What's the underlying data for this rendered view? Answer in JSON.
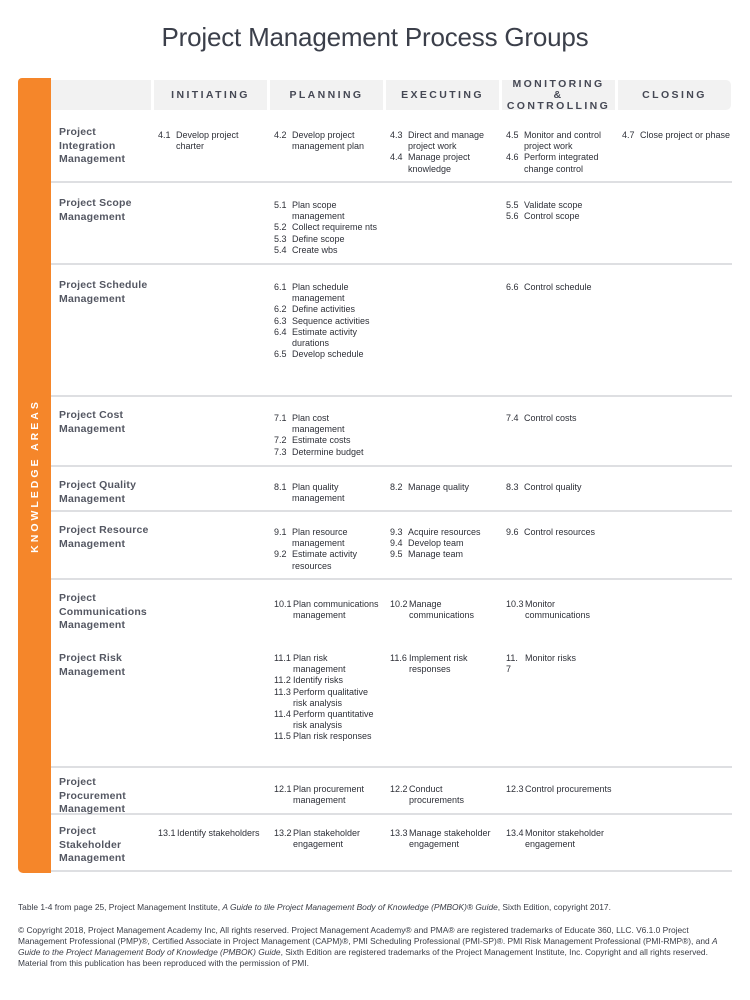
{
  "title": "Project Management Process Groups",
  "side_label": "KNOWLEDGE AREAS",
  "colors": {
    "accent": "#f5862a",
    "header_bg": "#f2f2f2",
    "separator": "#dedfe2"
  },
  "process_groups": [
    "INITIATING",
    "PLANNING",
    "EXECUTING",
    "MONITORING & CONTROLLING",
    "CLOSING"
  ],
  "knowledge_areas": [
    {
      "name": "Project Integration Management",
      "initiating": [
        {
          "num": "4.1",
          "text": "Develop project charter"
        }
      ],
      "planning": [
        {
          "num": "4.2",
          "text": "Develop project management plan"
        }
      ],
      "executing": [
        {
          "num": "4.3",
          "text": "Direct and manage project work"
        },
        {
          "num": "4.4",
          "text": "Manage project knowledge"
        }
      ],
      "monitoring": [
        {
          "num": "4.5",
          "text": "Monitor and control project work"
        },
        {
          "num": "4.6",
          "text": "Perform integrated change control"
        }
      ],
      "closing": [
        {
          "num": "4.7",
          "text": "Close project or phase"
        }
      ]
    },
    {
      "name": "Project Scope Management",
      "initiating": [],
      "planning": [
        {
          "num": "5.1",
          "text": "Plan scope management"
        },
        {
          "num": "5.2",
          "text": "Collect requireme nts"
        },
        {
          "num": "5.3",
          "text": "Define scope"
        },
        {
          "num": "5.4",
          "text": "Create wbs"
        }
      ],
      "executing": [],
      "monitoring": [
        {
          "num": "5.5",
          "text": "Validate scope"
        },
        {
          "num": "5.6",
          "text": "Control scope"
        }
      ],
      "closing": []
    },
    {
      "name": "Project Schedule Management",
      "initiating": [],
      "planning": [
        {
          "num": "6.1",
          "text": "Plan schedule management"
        },
        {
          "num": "6.2",
          "text": "Define activities"
        },
        {
          "num": "6.3",
          "text": "Sequence activities"
        },
        {
          "num": "6.4",
          "text": "Estimate activity durations"
        },
        {
          "num": "6.5",
          "text": "Develop schedule"
        }
      ],
      "executing": [],
      "monitoring": [
        {
          "num": "6.6",
          "text": "Control schedule"
        }
      ],
      "closing": []
    },
    {
      "name": "Project Cost Management",
      "initiating": [],
      "planning": [
        {
          "num": "7.1",
          "text": "Plan cost management"
        },
        {
          "num": "7.2",
          "text": "Estimate costs"
        },
        {
          "num": "7.3",
          "text": "Determine budget"
        }
      ],
      "executing": [],
      "monitoring": [
        {
          "num": "7.4",
          "text": "Control costs"
        }
      ],
      "closing": []
    },
    {
      "name": "Project Quality Management",
      "initiating": [],
      "planning": [
        {
          "num": "8.1",
          "text": "Plan quality management"
        }
      ],
      "executing": [
        {
          "num": "8.2",
          "text": "Manage quality"
        }
      ],
      "monitoring": [
        {
          "num": "8.3",
          "text": "Control quality"
        }
      ],
      "closing": []
    },
    {
      "name": "Project Resource Management",
      "initiating": [],
      "planning": [
        {
          "num": "9.1",
          "text": "Plan resource management"
        },
        {
          "num": "9.2",
          "text": "Estimate activity resources"
        }
      ],
      "executing": [
        {
          "num": "9.3",
          "text": "Acquire resources"
        },
        {
          "num": "9.4",
          "text": "Develop team"
        },
        {
          "num": "9.5",
          "text": "Manage team"
        }
      ],
      "monitoring": [
        {
          "num": "9.6",
          "text": "Control resources"
        }
      ],
      "closing": []
    },
    {
      "name": "Project Communications Management",
      "initiating": [],
      "planning": [
        {
          "num": "10.1",
          "text": "Plan communications management"
        }
      ],
      "executing": [
        {
          "num": "10.2",
          "text": "Manage communications"
        }
      ],
      "monitoring": [
        {
          "num": "10.3",
          "text": "Monitor communications"
        }
      ],
      "closing": []
    },
    {
      "name": "Project Risk Management",
      "initiating": [],
      "planning": [
        {
          "num": "11.1",
          "text": "Plan risk management"
        },
        {
          "num": "11.2",
          "text": "Identify risks"
        },
        {
          "num": "11.3",
          "text": "Perform qualitative risk analysis"
        },
        {
          "num": "11.4",
          "text": "Perform quantitative risk analysis"
        },
        {
          "num": "11.5",
          "text": "Plan risk responses"
        }
      ],
      "executing": [
        {
          "num": "11.6",
          "text": "Implement risk responses"
        }
      ],
      "monitoring": [
        {
          "num": "11. 7",
          "text": "Monitor risks"
        }
      ],
      "closing": []
    },
    {
      "name": "Project Procurement Management",
      "initiating": [],
      "planning": [
        {
          "num": "12.1",
          "text": "Plan procurement management"
        }
      ],
      "executing": [
        {
          "num": "12.2",
          "text": "Conduct procurements"
        }
      ],
      "monitoring": [
        {
          "num": "12.3",
          "text": "Control procurements"
        }
      ],
      "closing": []
    },
    {
      "name": "Project Stakeholder Management",
      "initiating": [
        {
          "num": "13.1",
          "text": "Identify stakeholders"
        }
      ],
      "planning": [
        {
          "num": "13.2",
          "text": "Plan stakeholder engagement"
        }
      ],
      "executing": [
        {
          "num": "13.3",
          "text": "Manage stakeholder engagement"
        }
      ],
      "monitoring": [
        {
          "num": "13.4",
          "text": "Monitor stakeholder engagement"
        }
      ],
      "closing": []
    }
  ],
  "footer": {
    "source_prefix": "Table 1-4 from page 25, Project Management Institute, ",
    "source_italic": "A Guide to tile Project Management Body of Knowledge (PMBOK)® Guide",
    "source_suffix": ", Sixth Edition, copyright 2017.",
    "copyright_part1": "© Copyright 2018, Project Management Academy Inc, All rights reserved. Project Management Academy® and PMA® are registered trademarks of Educate 360, LLC. V6.1.0 Project Management Professional (PMP)®, Certified Associate in Project Management (CAPM)®, PMI Scheduling Professional (PMI-SP)®. PMI Risk Management Professional (PMI-RMP®), and ",
    "copyright_italic": "A Guide to the Project Management Body of Knowledge (PMBOK) Guide",
    "copyright_part2": ", Sixth Edition are registered trademarks of the Project Management Institute, Inc. Copyright and all rights reserved. Material from this publication has been reproduced with the permission of PMI."
  }
}
